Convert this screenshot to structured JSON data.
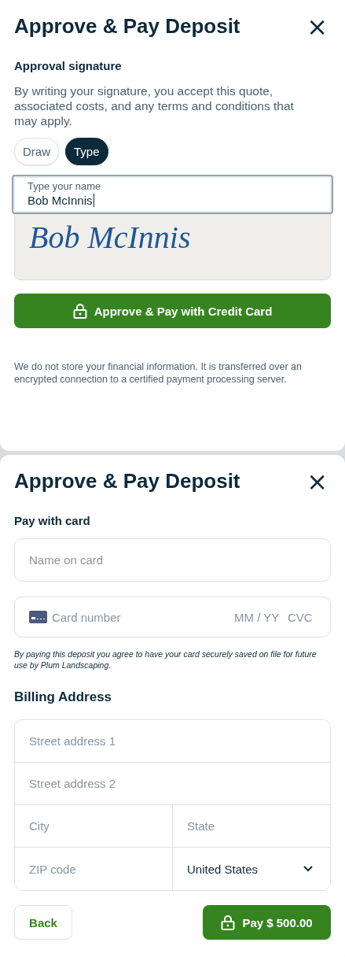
{
  "signature_dialog": {
    "title": "Approve & Pay Deposit",
    "close": "×",
    "section_title": "Approval signature",
    "description": "By writing your signature, you accept this quote, associated costs, and any terms and conditions that may apply.",
    "tabs": [
      {
        "label": "Draw",
        "selected": false
      },
      {
        "label": "Type",
        "selected": true
      }
    ],
    "name_field": {
      "label": "Type your name",
      "value": "Bob McInnis"
    },
    "signature_preview": "Bob McInnis",
    "approve_button": "Approve & Pay with Credit Card",
    "security_note": "We do not store your financial information. It is transferred over an encrypted connection to a certified payment processing server."
  },
  "payment_dialog": {
    "title": "Approve & Pay Deposit",
    "close": "×",
    "section_title": "Pay with card",
    "name_on_card": {
      "placeholder": "Name on card"
    },
    "card_field": {
      "number_placeholder": "Card number",
      "expiry_placeholder": "MM / YY",
      "cvc_placeholder": "CVC"
    },
    "consent_note": "By paying this deposit you agree to have your card securely saved on file for future use by Plum Landscaping.",
    "billing_title": "Billing Address",
    "billing_fields": [
      {
        "kind": "full",
        "placeholder": "Street address 1"
      },
      {
        "kind": "full",
        "placeholder": "Street address 2"
      },
      {
        "kind": "half",
        "placeholder": "City"
      },
      {
        "kind": "half",
        "placeholder": "State"
      },
      {
        "kind": "half",
        "placeholder": "ZIP code"
      },
      {
        "kind": "select",
        "value": "United States"
      }
    ],
    "back_button": "Back",
    "pay_button": "Pay $ 500.00"
  }
}
